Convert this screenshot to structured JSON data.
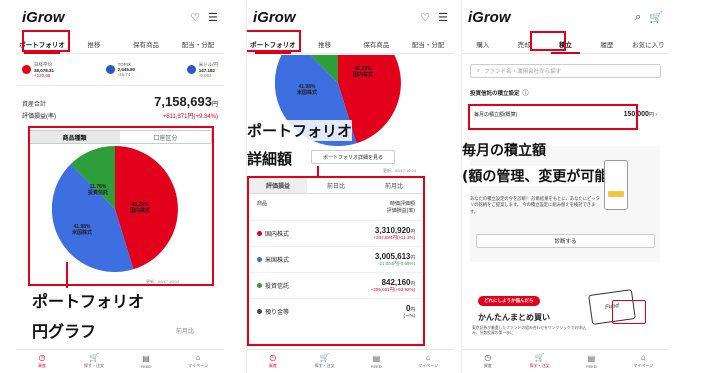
{
  "screen1": {
    "logo": "iGrow",
    "tabs": [
      "ポートフォリオ",
      "推移",
      "保有商品",
      "配当・分配"
    ],
    "tickers": [
      {
        "name": "日経平均",
        "value": "38,078.31",
        "change": "+120.65",
        "color": "#e3001b"
      },
      {
        "name": "TOPIX",
        "value": "2,645.80",
        "change": "-16.74",
        "color": "#2b57c6"
      },
      {
        "name": "米ドル/円",
        "value": "147.182",
        "change": "-0.062",
        "color": "#2b57c6"
      }
    ],
    "asset_label": "資産合計",
    "asset_value": "7,158,693",
    "asset_unit": "円",
    "pl_label": "評価損益(率)",
    "pl_value": "+611,871円(+9.34%)",
    "segments": [
      "商品種類",
      "口座区分"
    ],
    "pie_labels": [
      {
        "pct": "46.29",
        "unit": "%",
        "name": "国内株式"
      },
      {
        "pct": "41.98",
        "unit": "%",
        "name": "米国株式"
      },
      {
        "pct": "11.76",
        "unit": "%",
        "name": "投資信託"
      }
    ],
    "timestamp": "更新：09/17 10:03",
    "caption_line1": "ポートフォリオ",
    "caption_line2": "円グラフ",
    "bottom_tab_label": "前月比"
  },
  "screen2": {
    "logo": "iGrow",
    "tabs": [
      "ポートフォリオ",
      "推移",
      "保有商品",
      "配当・分配"
    ],
    "pie_labels": [
      {
        "pct": "46.29",
        "unit": "%",
        "name": "国内株式"
      },
      {
        "pct": "41.98",
        "unit": "%",
        "name": "米国株式"
      }
    ],
    "caption_line1": "ポートフォリオ",
    "caption_line2": "詳細額",
    "detail_link": "ポートフォリオ詳細を見る",
    "timestamp": "更新：09/17 10:03",
    "table_tabs": [
      "評価損益",
      "前日比",
      "前月比"
    ],
    "head_left": "商品",
    "head_right1": "時価評価額",
    "head_right2": "評価損益(率)",
    "rows": [
      {
        "name": "国内株式",
        "color": "#e3001b",
        "value": "3,310,920",
        "unit": "円",
        "sub": "+337,884円(+11.3%)",
        "sub_class": "r"
      },
      {
        "name": "米国株式",
        "color": "#3d6fe0",
        "value": "3,005,613",
        "unit": "円",
        "sub": "-21,044円(-0.69%)",
        "sub_class": "g"
      },
      {
        "name": "投資信託",
        "color": "#2e9e3a",
        "value": "842,160",
        "unit": "円",
        "sub": "+295,031円(+53.52%)",
        "sub_class": "r"
      },
      {
        "name": "預り金等",
        "color": "#444444",
        "value": "0",
        "unit": "円",
        "sub": "(ー%)",
        "sub_class": ""
      }
    ]
  },
  "screen3": {
    "logo": "iGrow",
    "tabs": [
      "購入",
      "売却",
      "積立",
      "履歴",
      "お気に入り"
    ],
    "search_placeholder": "ファンド名・運用会社から探す",
    "settings_label": "投資信託の積立設定",
    "monthly_label": "毎月の積立額(概算)",
    "monthly_value": "150,000",
    "monthly_unit": "円",
    "caption_line1": "毎月の積立額",
    "caption_line2": "(額の管理、変更が可能)",
    "promo_text": "あなたの積立設定の今を診断！ 診断結果をもとに、あなたにピッタリの銘柄をご提案します。 今の積立設定に組み替えを検討できます。",
    "diagnose_button": "診断する",
    "pill_text": "どれにしようか悩んだら",
    "heading": "かんたんまとめ買い",
    "sub_text": "東京証券が厳選したファンドの組み合わせをワンクリックでお申込み。分散投資の第一歩に",
    "fund_label": "Fund"
  },
  "bottomnav": [
    {
      "label": "資産",
      "icon": "◷"
    },
    {
      "label": "探す・注文",
      "icon": "🛒"
    },
    {
      "label": "FEED",
      "icon": "▤"
    },
    {
      "label": "マイページ",
      "icon": "⌂"
    }
  ],
  "colors": {
    "red": "#e3001b",
    "blue": "#3d6fe0",
    "green": "#2e9e3a"
  }
}
